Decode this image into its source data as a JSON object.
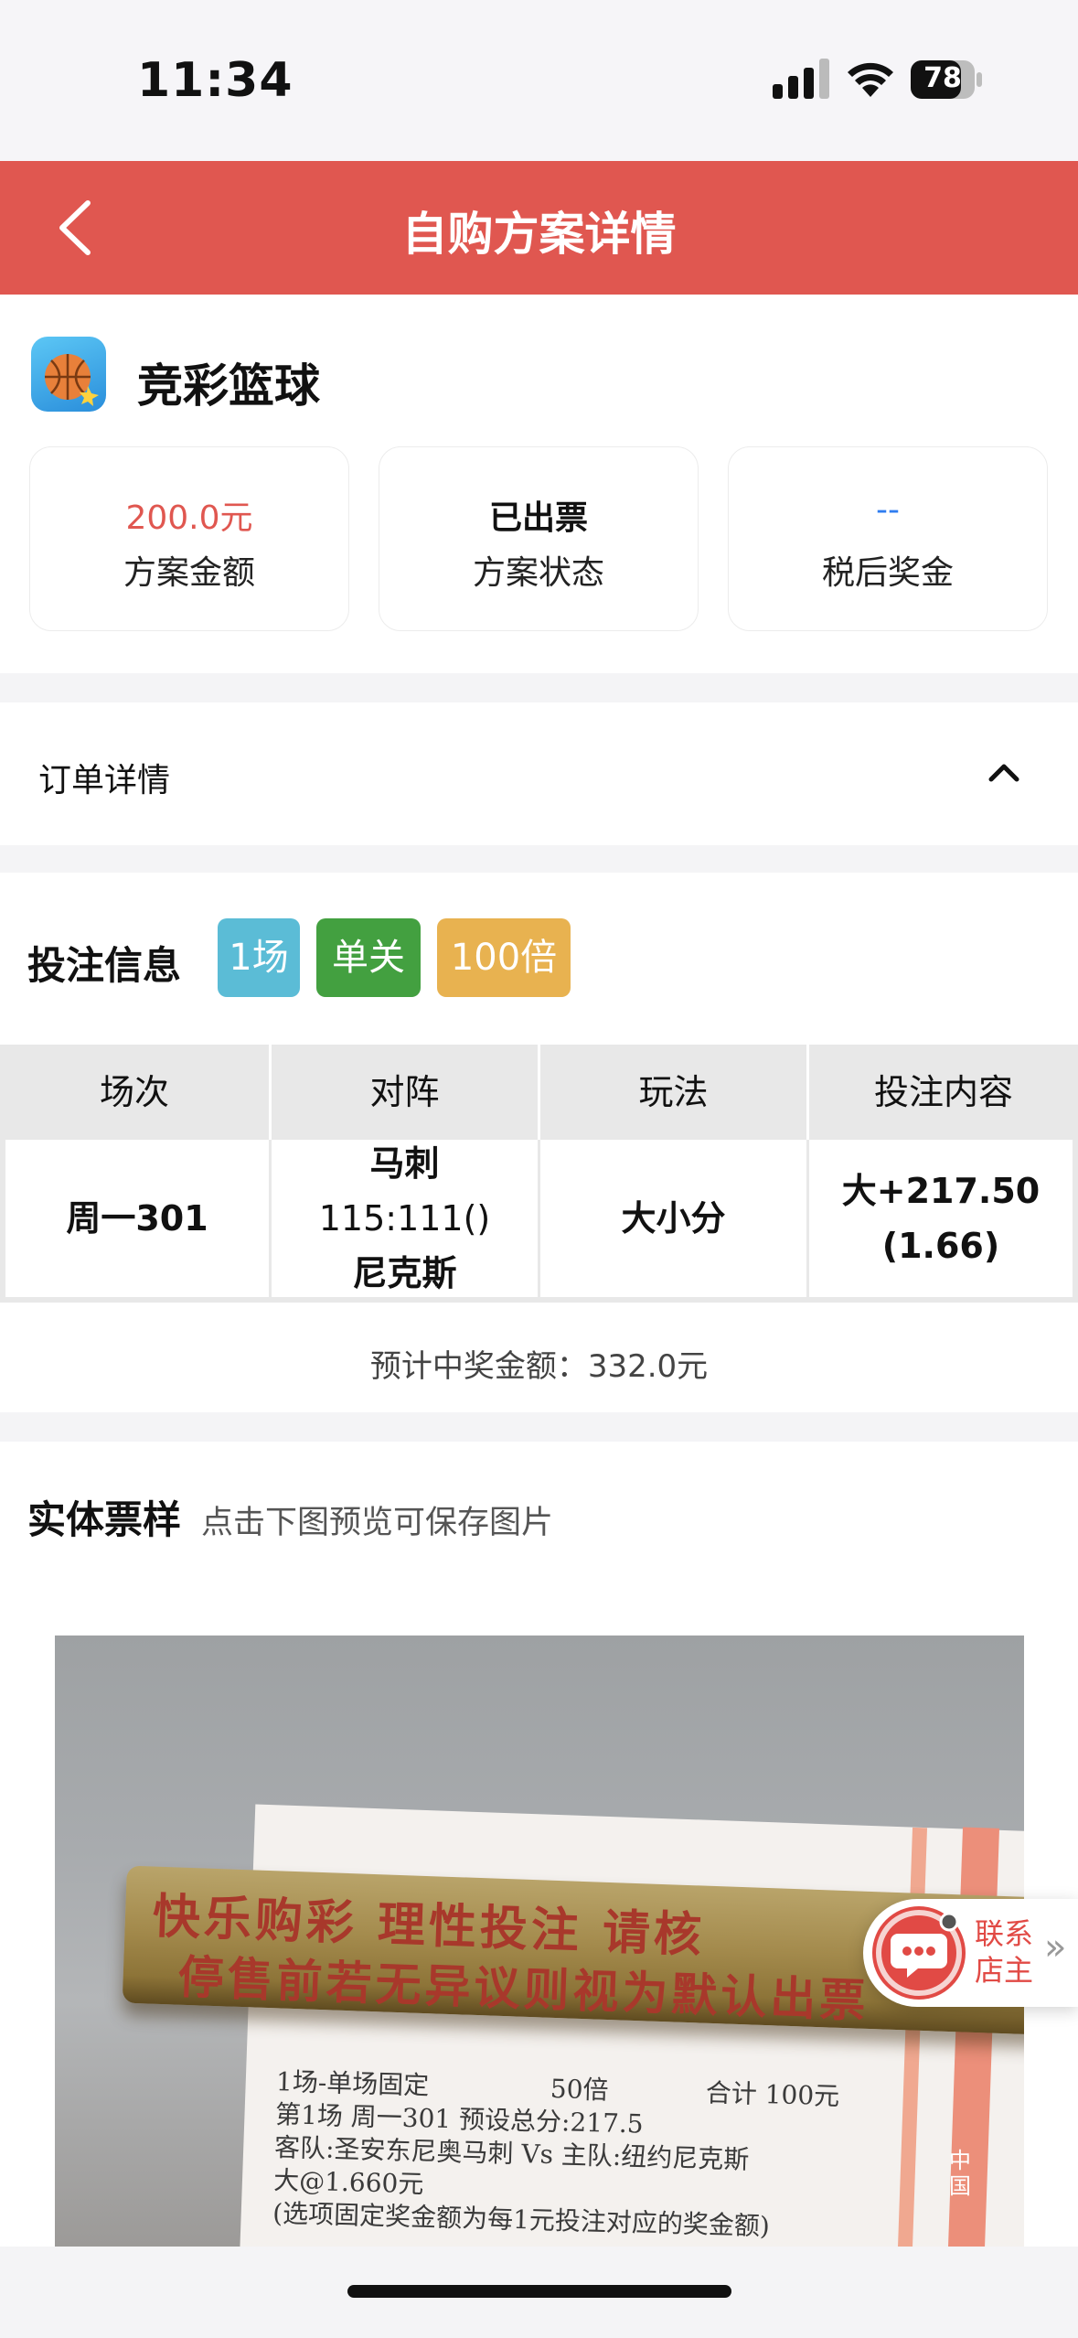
{
  "status_bar": {
    "time": "11:34",
    "battery": "78"
  },
  "nav": {
    "title": "自购方案详情"
  },
  "lottery": {
    "name": "竞彩篮球"
  },
  "summary": [
    {
      "value": "200.0元",
      "label": "方案金额",
      "value_color": "#e05750"
    },
    {
      "value": "已出票",
      "label": "方案状态",
      "value_color": "#111111"
    },
    {
      "value": "--",
      "label": "税后奖金",
      "value_color": "#2f7df0"
    }
  ],
  "order": {
    "title": "订单详情"
  },
  "bet": {
    "title": "投注信息",
    "tags": [
      {
        "text": "1场",
        "color": "#5bbcd6"
      },
      {
        "text": "单关",
        "color": "#43a040"
      },
      {
        "text": "100倍",
        "color": "#e8b250"
      }
    ],
    "headers": [
      "场次",
      "对阵",
      "玩法",
      "投注内容"
    ],
    "row": {
      "match_no": "周一301",
      "away_team": "马刺",
      "score": "115:111()",
      "home_team": "尼克斯",
      "play": "大小分",
      "content_line1": "大+217.50",
      "content_line2": "(1.66)"
    },
    "expected": "预计中奖金额：332.0元"
  },
  "ticket": {
    "title": "实体票样",
    "hint": "点击下图预览可保存图片",
    "photo_text": {
      "line1": "快乐购彩  理性投注  请核",
      "line2": "停售前若无异议则视为默认出票",
      "row1_left": "1场-单场固定",
      "row1_mid": "50倍",
      "row1_right": "合计  100元",
      "row2": "第1场  周一301 预设总分:217.5",
      "row3": "客队:圣安东尼奥马刺 Vs 主队:纽约尼克斯",
      "row4": "大@1.660元",
      "row5": "(选项固定奖金额为每1元投注对应的奖金额)",
      "side": "中国"
    }
  },
  "contact": {
    "line1": "联系",
    "line2": "店主"
  },
  "colors": {
    "brand_red": "#e05750",
    "accent_blue": "#2f7df0"
  }
}
